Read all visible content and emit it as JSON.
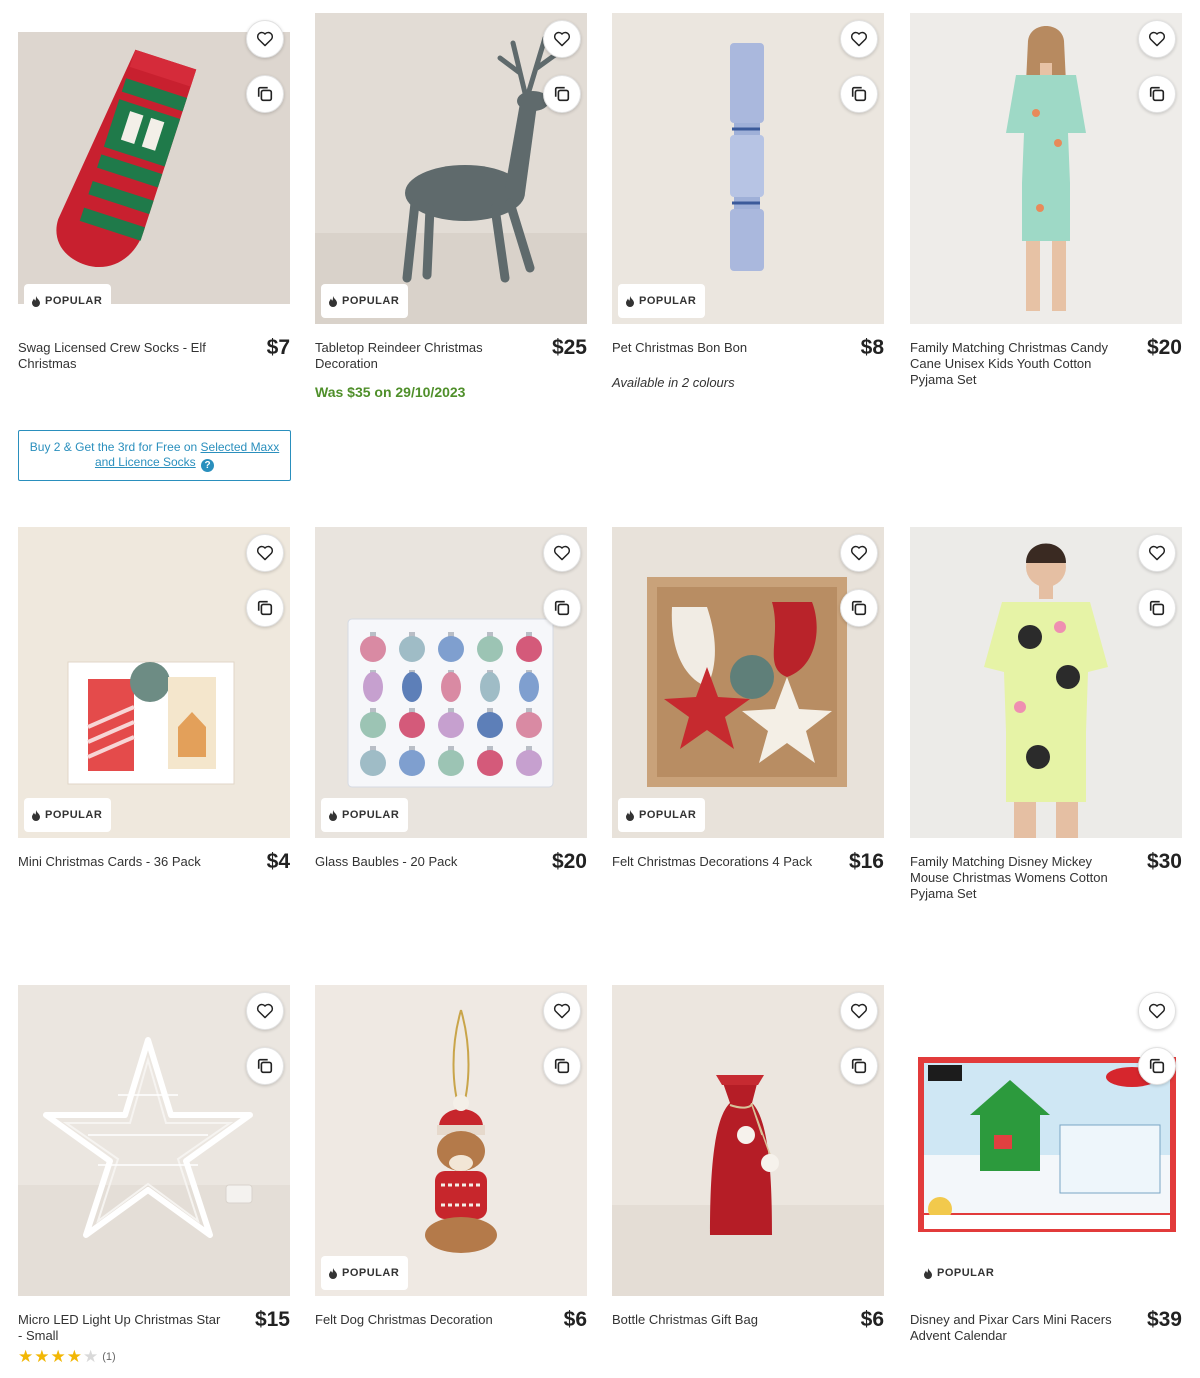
{
  "badge_label": "POPULAR",
  "colors": {
    "promo": "#2a8fbd",
    "was_price": "#4f8f2a",
    "star_filled": "#f2b705",
    "star_empty": "#d9d9d9"
  },
  "products": [
    {
      "name": "Swag Licensed Crew Socks - Elf Christmas",
      "price": "$7",
      "popular": true,
      "promo": {
        "prefix": "Buy 2 & Get the 3rd for Free on ",
        "link": "Selected Maxx and Licence Socks",
        "help": "?"
      }
    },
    {
      "name": "Tabletop Reindeer Christmas Decoration",
      "price": "$25",
      "popular": true,
      "was": "Was $35 on 29/10/2023"
    },
    {
      "name": "Pet Christmas Bon Bon",
      "price": "$8",
      "popular": true,
      "availability": "Available in 2 colours"
    },
    {
      "name": "Family Matching Christmas Candy Cane Unisex Kids Youth Cotton Pyjama Set",
      "price": "$20",
      "popular": false
    },
    {
      "name": "Mini Christmas Cards - 36 Pack",
      "price": "$4",
      "popular": true
    },
    {
      "name": "Glass Baubles - 20 Pack",
      "price": "$20",
      "popular": true
    },
    {
      "name": "Felt Christmas Decorations 4 Pack",
      "price": "$16",
      "popular": true
    },
    {
      "name": "Family Matching Disney Mickey Mouse Christmas Womens Cotton Pyjama Set",
      "price": "$30",
      "popular": false
    },
    {
      "name": "Micro LED Light Up Christmas Star - Small",
      "price": "$15",
      "popular": false,
      "rating": 4,
      "rating_count": "(1)"
    },
    {
      "name": "Felt Dog Christmas Decoration",
      "price": "$6",
      "popular": true
    },
    {
      "name": "Bottle Christmas Gift Bag",
      "price": "$6",
      "popular": false
    },
    {
      "name": "Disney and Pixar Cars Mini Racers Advent Calendar",
      "price": "$39",
      "popular": true
    }
  ]
}
